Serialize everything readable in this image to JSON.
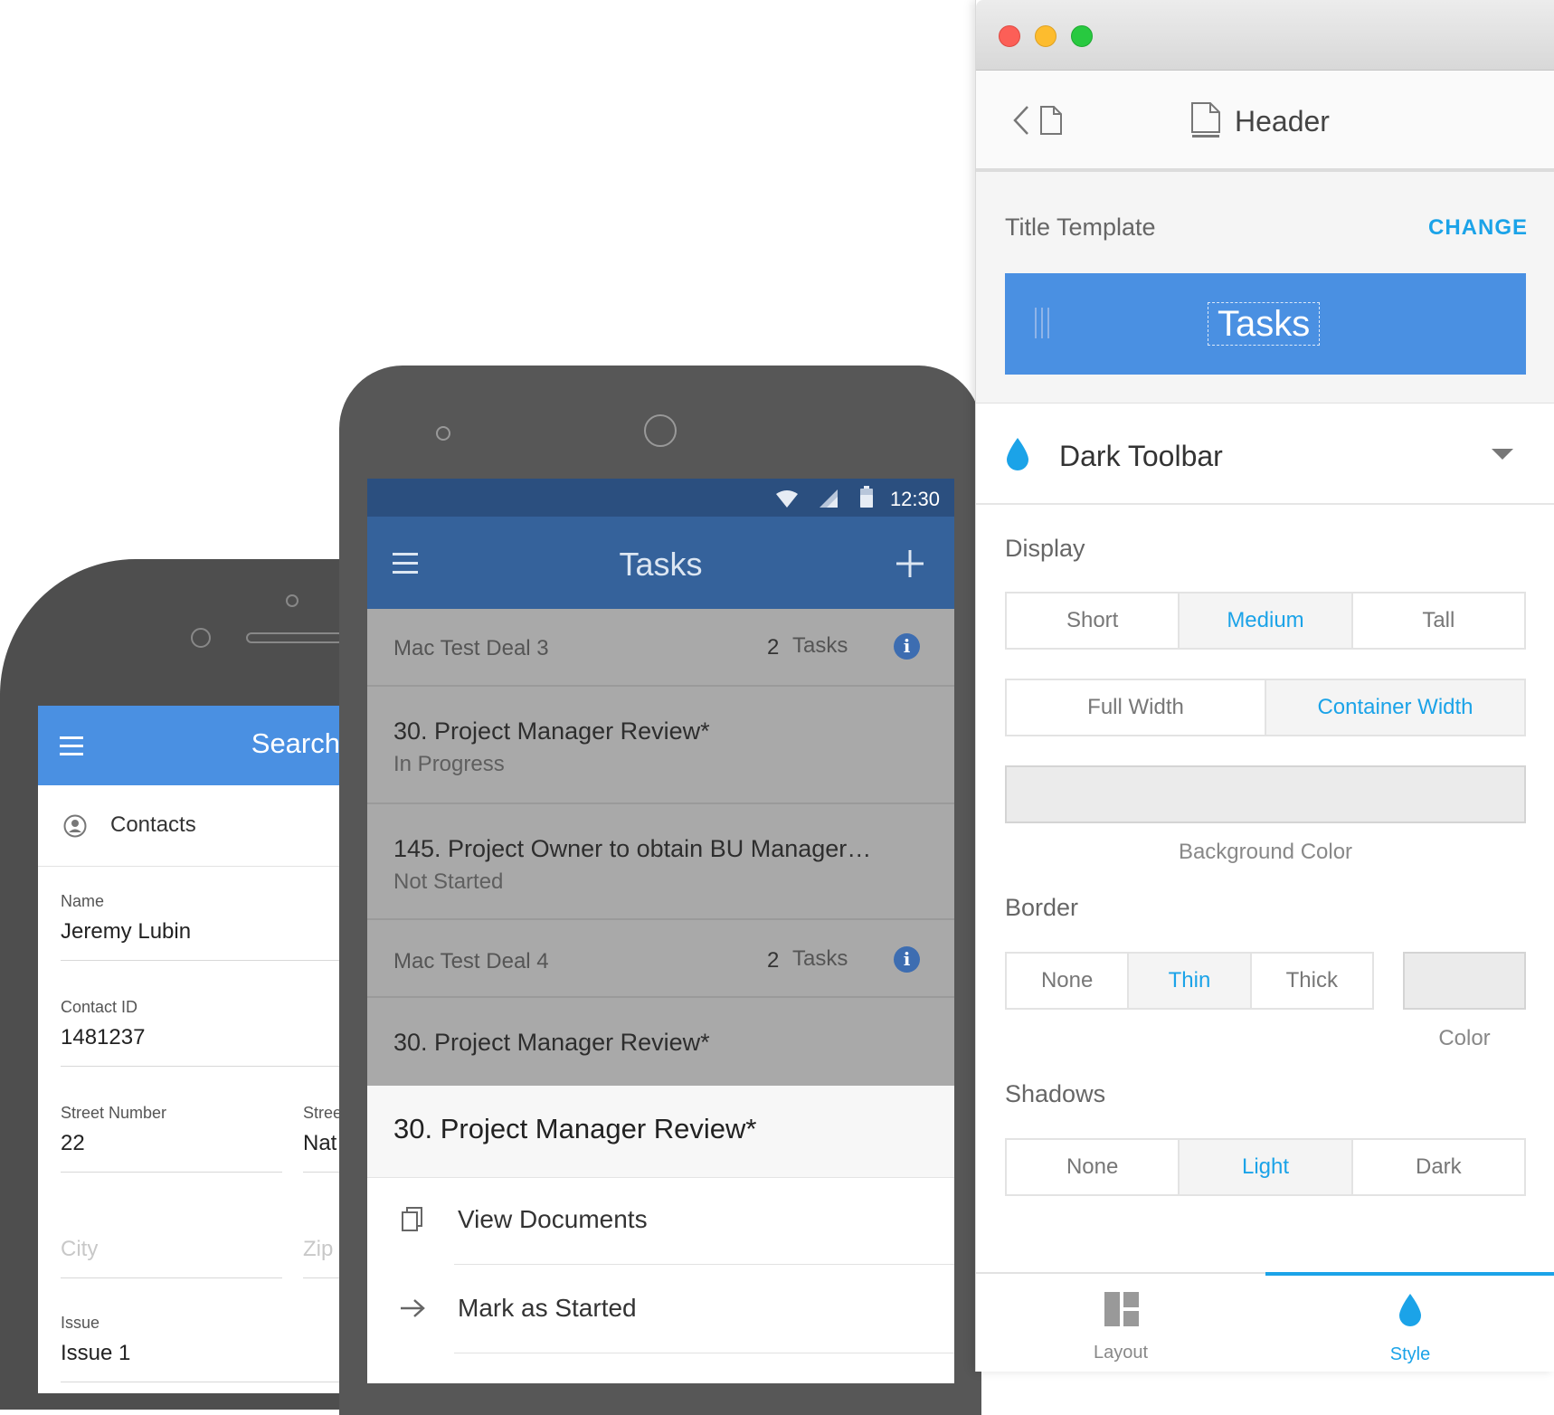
{
  "iphone": {
    "header_title": "Search",
    "section_label": "Contacts",
    "fields": {
      "name_label": "Name",
      "name_value": "Jeremy Lubin",
      "contact_id_label": "Contact ID",
      "contact_id_value": "1481237",
      "street_number_label": "Street Number",
      "street_number_value": "22",
      "street_label": "Stree",
      "street_value": "Nat",
      "city_placeholder": "City",
      "zip_placeholder": "Zip",
      "issue_label": "Issue",
      "issue_value": "Issue 1"
    }
  },
  "android": {
    "status_time": "12:30",
    "app_title": "Tasks",
    "groups": [
      {
        "name": "Mac Test Deal 3",
        "count": "2",
        "count_label": "Tasks"
      },
      {
        "name": "Mac Test Deal 4",
        "count": "2",
        "count_label": "Tasks"
      }
    ],
    "tasks": [
      {
        "title": "30. Project Manager Review*",
        "status": "In Progress"
      },
      {
        "title": "145. Project Owner to obtain BU Manager…",
        "status": "Not Started"
      },
      {
        "title": "30. Project Manager Review*",
        "status": ""
      }
    ],
    "sheet": {
      "title": "30. Project Manager Review*",
      "actions": [
        {
          "label": "View Documents",
          "icon": "documents-icon"
        },
        {
          "label": "Mark as Started",
          "icon": "arrow-right-icon"
        }
      ]
    }
  },
  "panel": {
    "header_title": "Header",
    "title_template_label": "Title Template",
    "change_label": "CHANGE",
    "preview_text": "Tasks",
    "theme_name": "Dark Toolbar",
    "display": {
      "label": "Display",
      "height_options": [
        "Short",
        "Medium",
        "Tall"
      ],
      "height_selected": "Medium",
      "width_options": [
        "Full Width",
        "Container Width"
      ],
      "width_selected": "Container Width",
      "background_color_label": "Background Color"
    },
    "border": {
      "label": "Border",
      "options": [
        "None",
        "Thin",
        "Thick"
      ],
      "selected": "Thin",
      "color_label": "Color"
    },
    "shadows": {
      "label": "Shadows",
      "options": [
        "None",
        "Light",
        "Dark"
      ],
      "selected": "Light"
    },
    "tabs": [
      {
        "label": "Layout",
        "icon": "layout-icon",
        "active": false
      },
      {
        "label": "Style",
        "icon": "drop-icon",
        "active": true
      }
    ],
    "colors": {
      "accent": "#1ba3e8",
      "preview_bg": "#4a90e2",
      "tab_inactive": "#888888"
    }
  }
}
